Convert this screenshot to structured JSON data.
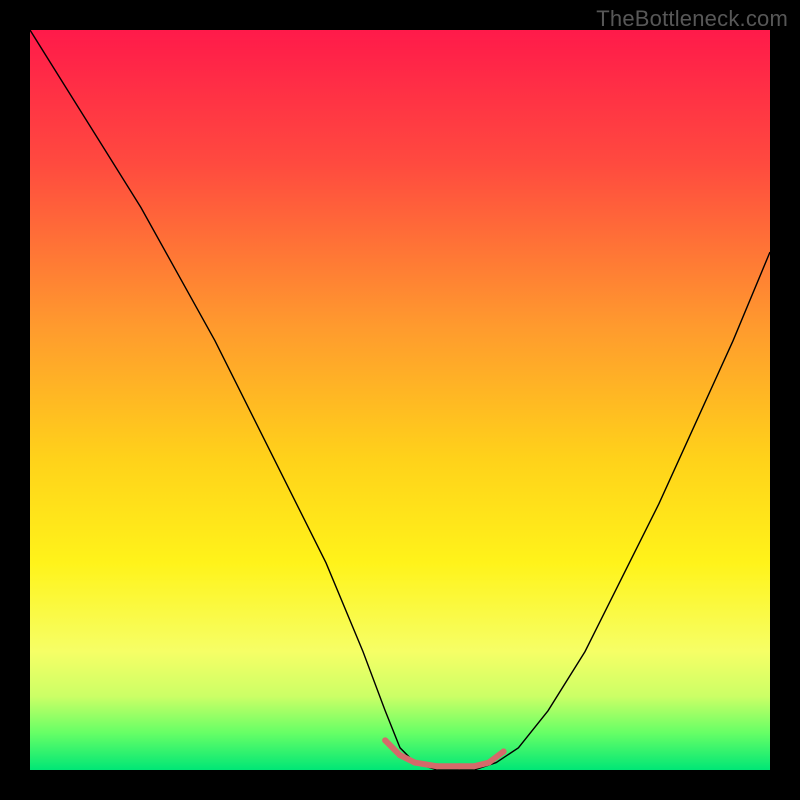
{
  "watermark": "TheBottleneck.com",
  "chart_data": {
    "type": "line",
    "title": "",
    "xlabel": "",
    "ylabel": "",
    "xlim": [
      0,
      100
    ],
    "ylim": [
      0,
      100
    ],
    "background_gradient": {
      "stops": [
        {
          "offset": 0,
          "color": "#ff1a4a"
        },
        {
          "offset": 0.18,
          "color": "#ff4a3f"
        },
        {
          "offset": 0.4,
          "color": "#ff9a2e"
        },
        {
          "offset": 0.58,
          "color": "#ffd21a"
        },
        {
          "offset": 0.72,
          "color": "#fff31a"
        },
        {
          "offset": 0.84,
          "color": "#f6ff66"
        },
        {
          "offset": 0.9,
          "color": "#ccff66"
        },
        {
          "offset": 0.95,
          "color": "#66ff66"
        },
        {
          "offset": 1.0,
          "color": "#00e676"
        }
      ]
    },
    "series": [
      {
        "name": "curve",
        "color": "#000000",
        "width": 1.4,
        "x": [
          0,
          5,
          10,
          15,
          20,
          25,
          30,
          35,
          40,
          45,
          48,
          50,
          52,
          55,
          58,
          60,
          63,
          66,
          70,
          75,
          80,
          85,
          90,
          95,
          100
        ],
        "y": [
          100,
          92,
          84,
          76,
          67,
          58,
          48,
          38,
          28,
          16,
          8,
          3,
          1,
          0,
          0,
          0,
          1,
          3,
          8,
          16,
          26,
          36,
          47,
          58,
          70
        ]
      }
    ],
    "highlight": {
      "name": "bottom-band",
      "color": "#d46a6a",
      "x": [
        48,
        50,
        52,
        55,
        58,
        60,
        62,
        64
      ],
      "y": [
        4,
        2,
        1,
        0.5,
        0.5,
        0.5,
        1,
        2.5
      ],
      "marker_size": 6,
      "stroke_width": 6
    }
  }
}
